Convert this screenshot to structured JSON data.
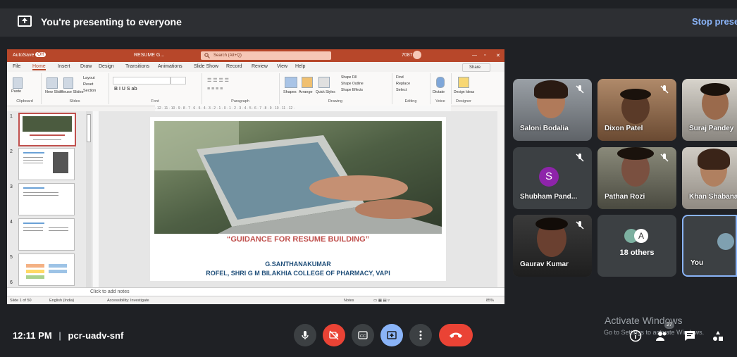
{
  "topbar": {
    "presenting_text": "You're presenting to everyone",
    "stop_label": "Stop presenting"
  },
  "powerpoint": {
    "title_left": "AutoSave",
    "toggle": "Off",
    "doc_title": "RESUME G...",
    "search_placeholder": "Search (Alt+Q)",
    "user": "7087",
    "menu": [
      "File",
      "Home",
      "Insert",
      "Draw",
      "Design",
      "Transitions",
      "Animations",
      "Slide Show",
      "Record",
      "Review",
      "View",
      "Help"
    ],
    "share_label": "Share",
    "ribbon_groups": [
      "Clipboard",
      "Slides",
      "Font",
      "Paragraph",
      "Drawing",
      "Editing",
      "Voice",
      "Designer"
    ],
    "ribbon_items": {
      "paste": "Paste",
      "new_slide": "New Slide",
      "reuse_slides": "Reuse Slides",
      "layout": "Layout",
      "reset": "Reset",
      "section": "Section",
      "shapes": "Shapes",
      "arrange": "Arrange",
      "quick_styles": "Quick Styles",
      "shape_fill": "Shape Fill",
      "shape_outline": "Shape Outline",
      "shape_effects": "Shape Effects",
      "find": "Find",
      "replace": "Replace",
      "select": "Select",
      "dictate": "Dictate",
      "design_ideas": "Design Ideas"
    },
    "ruler_text": "· 12 · 11 · 10 · 9 · 8 · 7 · 6 · 5 · 4 · 3 · 2 · 1 · 0 · 1 · 2 · 3 · 4 · 5 · 6 · 7 · 8 · 9 · 10 · 11 · 12 ·",
    "thumb_numbers": [
      "1",
      "2",
      "3",
      "4",
      "5",
      "6"
    ],
    "slide": {
      "title": "“GUIDANCE FOR RESUME BUILDING”",
      "author": "G.SANTHANAKUMAR",
      "affiliation": "ROFEL, SHRI G M BILAKHIA COLLEGE OF PHARMACY, VAPI"
    },
    "notes_placeholder": "Click to add notes",
    "status": {
      "slide_of": "Slide 1 of 50",
      "language": "English (India)",
      "accessibility": "Accessibility: Investigate",
      "notes": "Notes",
      "zoom": "85%"
    }
  },
  "participants": [
    {
      "name": "Saloni Bodalia",
      "muted": true
    },
    {
      "name": "Dixon Patel",
      "muted": true
    },
    {
      "name": "Suraj Pandey",
      "muted": false
    },
    {
      "name": "Shubham Pand...",
      "muted": true,
      "initial": "S"
    },
    {
      "name": "Pathan Rozi",
      "muted": true
    },
    {
      "name": "Khan Shabana",
      "muted": false
    },
    {
      "name": "Gaurav Kumar",
      "muted": true
    },
    {
      "name": "18 others",
      "initial": "A"
    },
    {
      "name": "You"
    }
  ],
  "bottombar": {
    "time": "12:11 PM",
    "separator": "|",
    "meeting_code": "pcr-uadv-snf",
    "people_count": "27"
  },
  "windows_watermark": {
    "line1": "Activate Windows",
    "line2": "Go to Settings to activate Windows."
  },
  "colors": {
    "brand_red": "#ea4335",
    "accent_blue": "#8ab4f8",
    "ppt_red": "#b7472a",
    "avatar_purple": "#8e24aa"
  }
}
